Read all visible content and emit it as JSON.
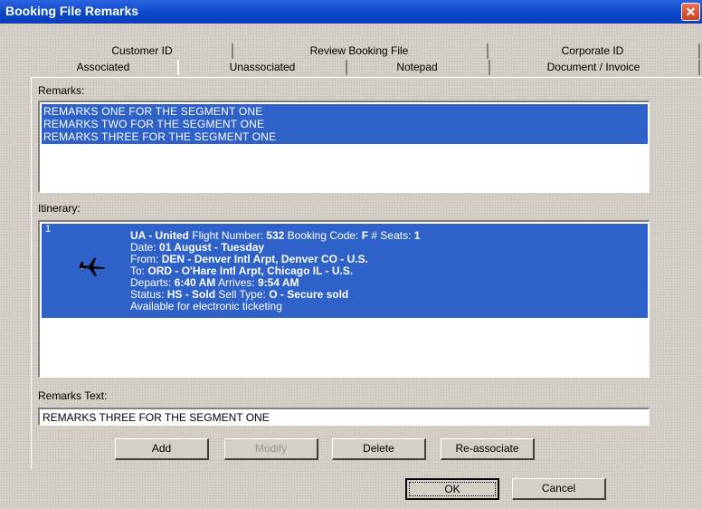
{
  "window": {
    "title": "Booking File Remarks",
    "close": "✕"
  },
  "tabs_row1": [
    "Customer ID",
    "Review Booking File",
    "Corporate ID"
  ],
  "tabs_row2": [
    "Associated",
    "Unassociated",
    "Notepad",
    "Document / Invoice"
  ],
  "remarks": {
    "label": "Remarks:",
    "items": [
      "REMARKS ONE FOR THE SEGMENT ONE",
      "REMARKS TWO FOR THE SEGMENT ONE",
      "REMARKS THREE FOR  THE SEGMENT ONE"
    ]
  },
  "itinerary": {
    "label": "Itinerary:",
    "segment_number": "1",
    "airline": "UA - United",
    "flight_number_label": "Flight Number:",
    "flight_number": "532",
    "booking_code_label": "Booking Code:",
    "booking_code": "F",
    "seats_label": "# Seats:",
    "seats": "1",
    "date_label": "Date:",
    "date": "01 August - Tuesday",
    "from_label": "From:",
    "from": "DEN - Denver Intl Arpt, Denver CO - U.S.",
    "to_label": "To:",
    "to": "ORD - O'Hare Intl Arpt, Chicago IL - U.S.",
    "departs_label": "Departs:",
    "departs": "6:40 AM",
    "arrives_label": "Arrives:",
    "arrives": "9:54 AM",
    "status_label": "Status:",
    "status": "HS - Sold",
    "sell_type_label": "Sell Type:",
    "sell_type": "O - Secure sold",
    "note": "Available for electronic ticketing"
  },
  "remarks_text": {
    "label": "Remarks Text:",
    "value": "REMARKS THREE FOR  THE SEGMENT ONE"
  },
  "buttons": {
    "add": "Add",
    "modify": "Modify",
    "delete": "Delete",
    "reassociate": "Re-associate",
    "ok": "OK",
    "cancel": "Cancel"
  },
  "colors": {
    "selection": "#2e62c8",
    "titlebar": "#0b45c8",
    "dialog": "#d4d0c8"
  }
}
